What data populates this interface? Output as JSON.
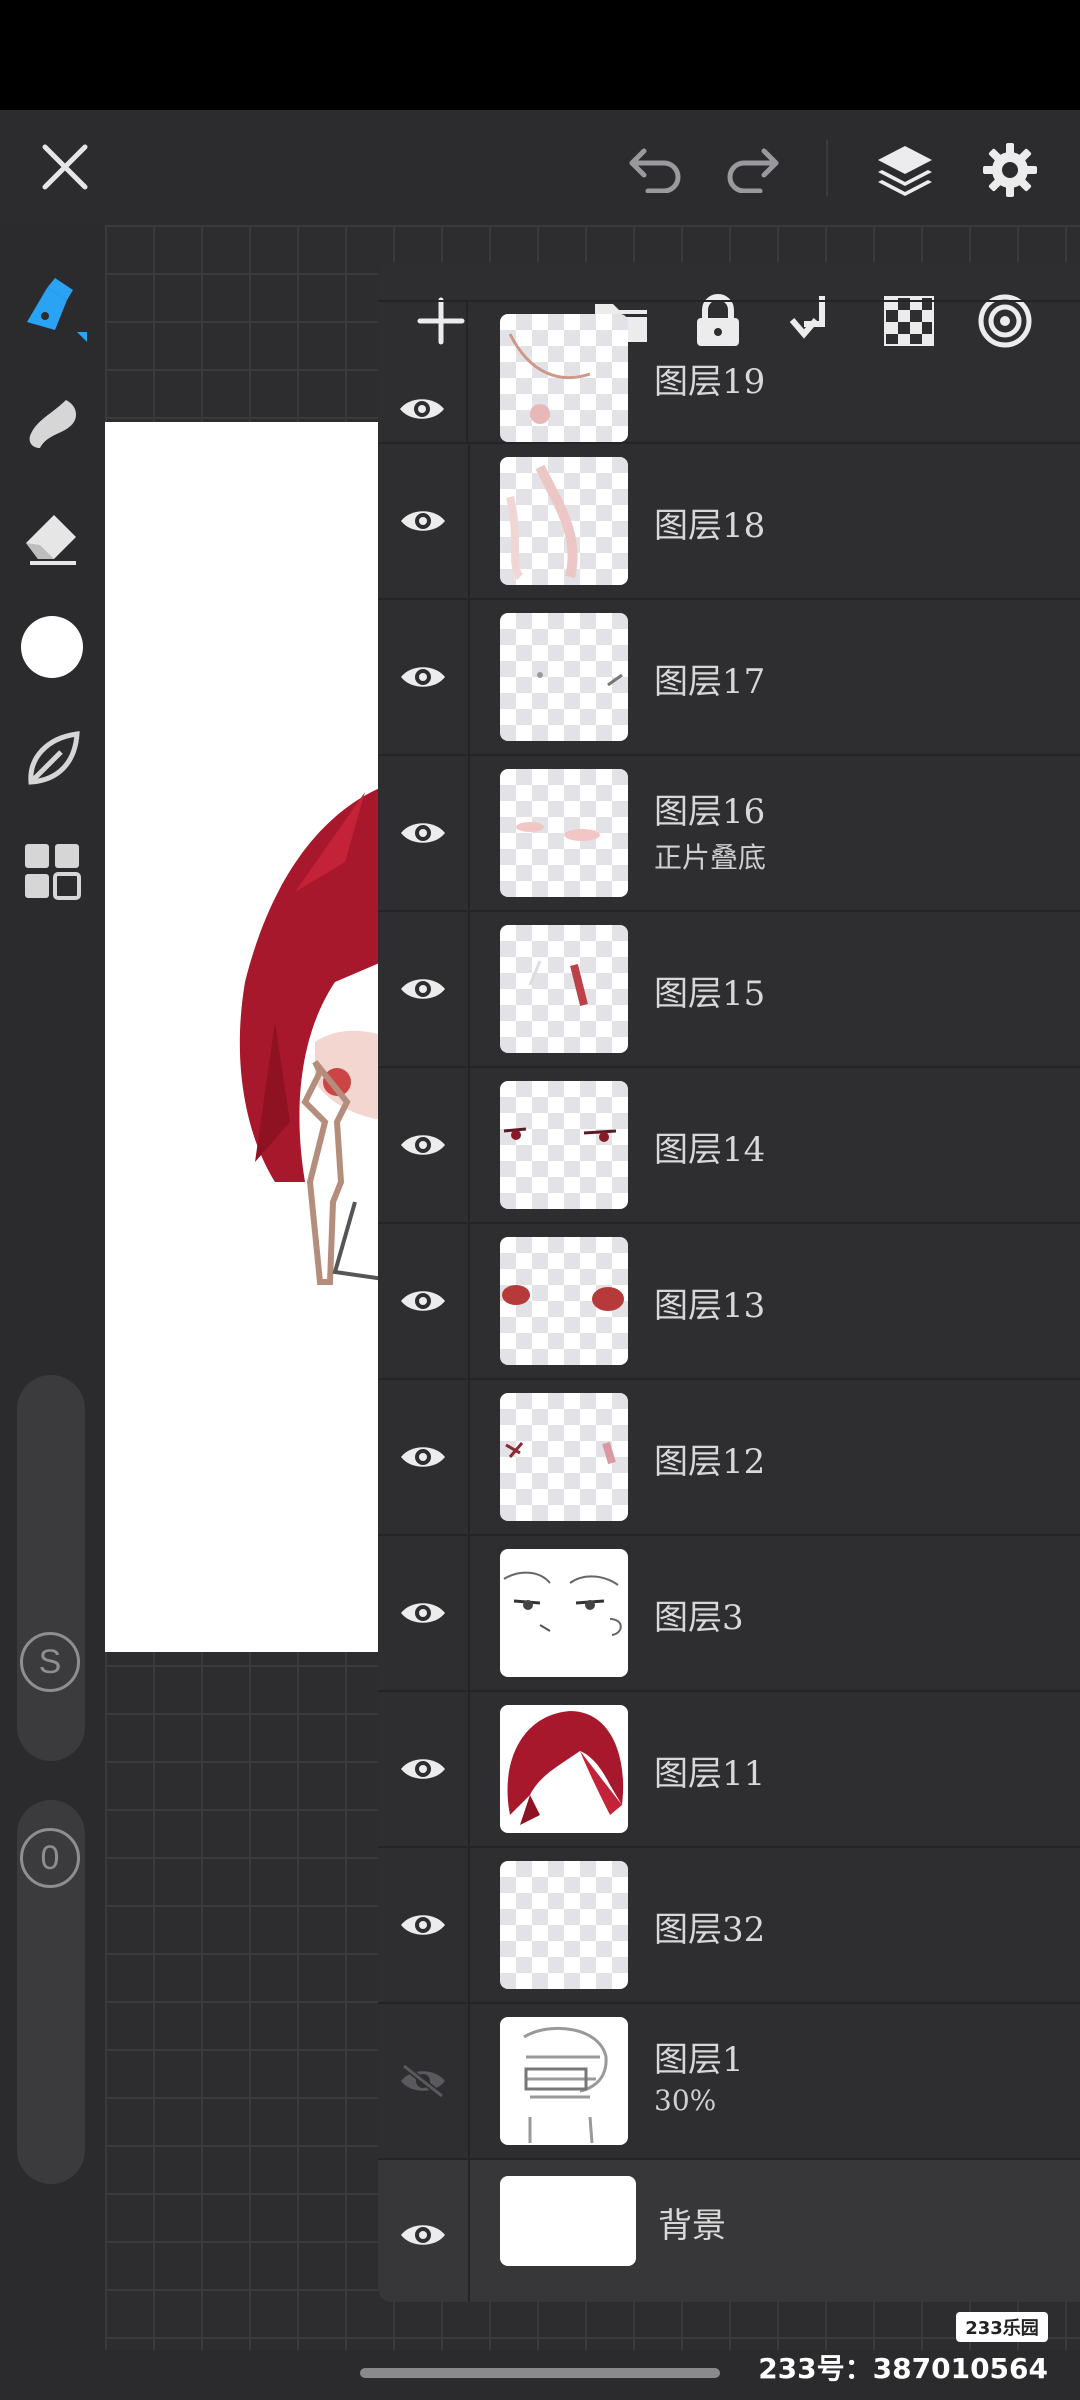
{
  "app": {
    "accent": "#2aa3f5",
    "icons": {
      "close": "close-icon",
      "undo": "undo-icon",
      "redo": "redo-icon",
      "layers": "layers-icon",
      "settings": "gear-icon"
    }
  },
  "tools": [
    {
      "name": "brush-pen-icon",
      "active": true
    },
    {
      "name": "smudge-icon",
      "active": false
    },
    {
      "name": "eraser-icon",
      "active": false
    },
    {
      "name": "color-circle-icon",
      "active": false
    },
    {
      "name": "leaf-icon",
      "active": false
    },
    {
      "name": "grid-apps-icon",
      "active": false
    }
  ],
  "sliders": {
    "size_label": "S",
    "opacity_label": "0"
  },
  "layer_toolbar": [
    "add-icon",
    "folder-icon",
    "lock-icon",
    "merge-down-icon",
    "transparency-icon",
    "layer-target-icon"
  ],
  "layers": [
    {
      "name": "图层19",
      "sub": "",
      "visible": true,
      "thumb": "sketch-face"
    },
    {
      "name": "图层18",
      "sub": "",
      "visible": true,
      "thumb": "pink-strokes"
    },
    {
      "name": "图层17",
      "sub": "",
      "visible": true,
      "thumb": "dots"
    },
    {
      "name": "图层16",
      "sub": "正片叠底",
      "visible": true,
      "thumb": "blush"
    },
    {
      "name": "图层15",
      "sub": "",
      "visible": true,
      "thumb": "streak"
    },
    {
      "name": "图层14",
      "sub": "",
      "visible": true,
      "thumb": "eyes-lines"
    },
    {
      "name": "图层13",
      "sub": "",
      "visible": true,
      "thumb": "eyes-red"
    },
    {
      "name": "图层12",
      "sub": "",
      "visible": true,
      "thumb": "marks"
    },
    {
      "name": "图层3",
      "sub": "",
      "visible": true,
      "thumb": "lineart"
    },
    {
      "name": "图层11",
      "sub": "",
      "visible": true,
      "thumb": "hair"
    },
    {
      "name": "图层32",
      "sub": "",
      "visible": true,
      "thumb": "empty"
    },
    {
      "name": "图层1",
      "sub": "30%",
      "visible": false,
      "thumb": "sketch"
    },
    {
      "name": "背景",
      "sub": "",
      "visible": true,
      "thumb": "white"
    }
  ],
  "watermark": {
    "logo": "233乐园",
    "text": "233号：387010564"
  }
}
